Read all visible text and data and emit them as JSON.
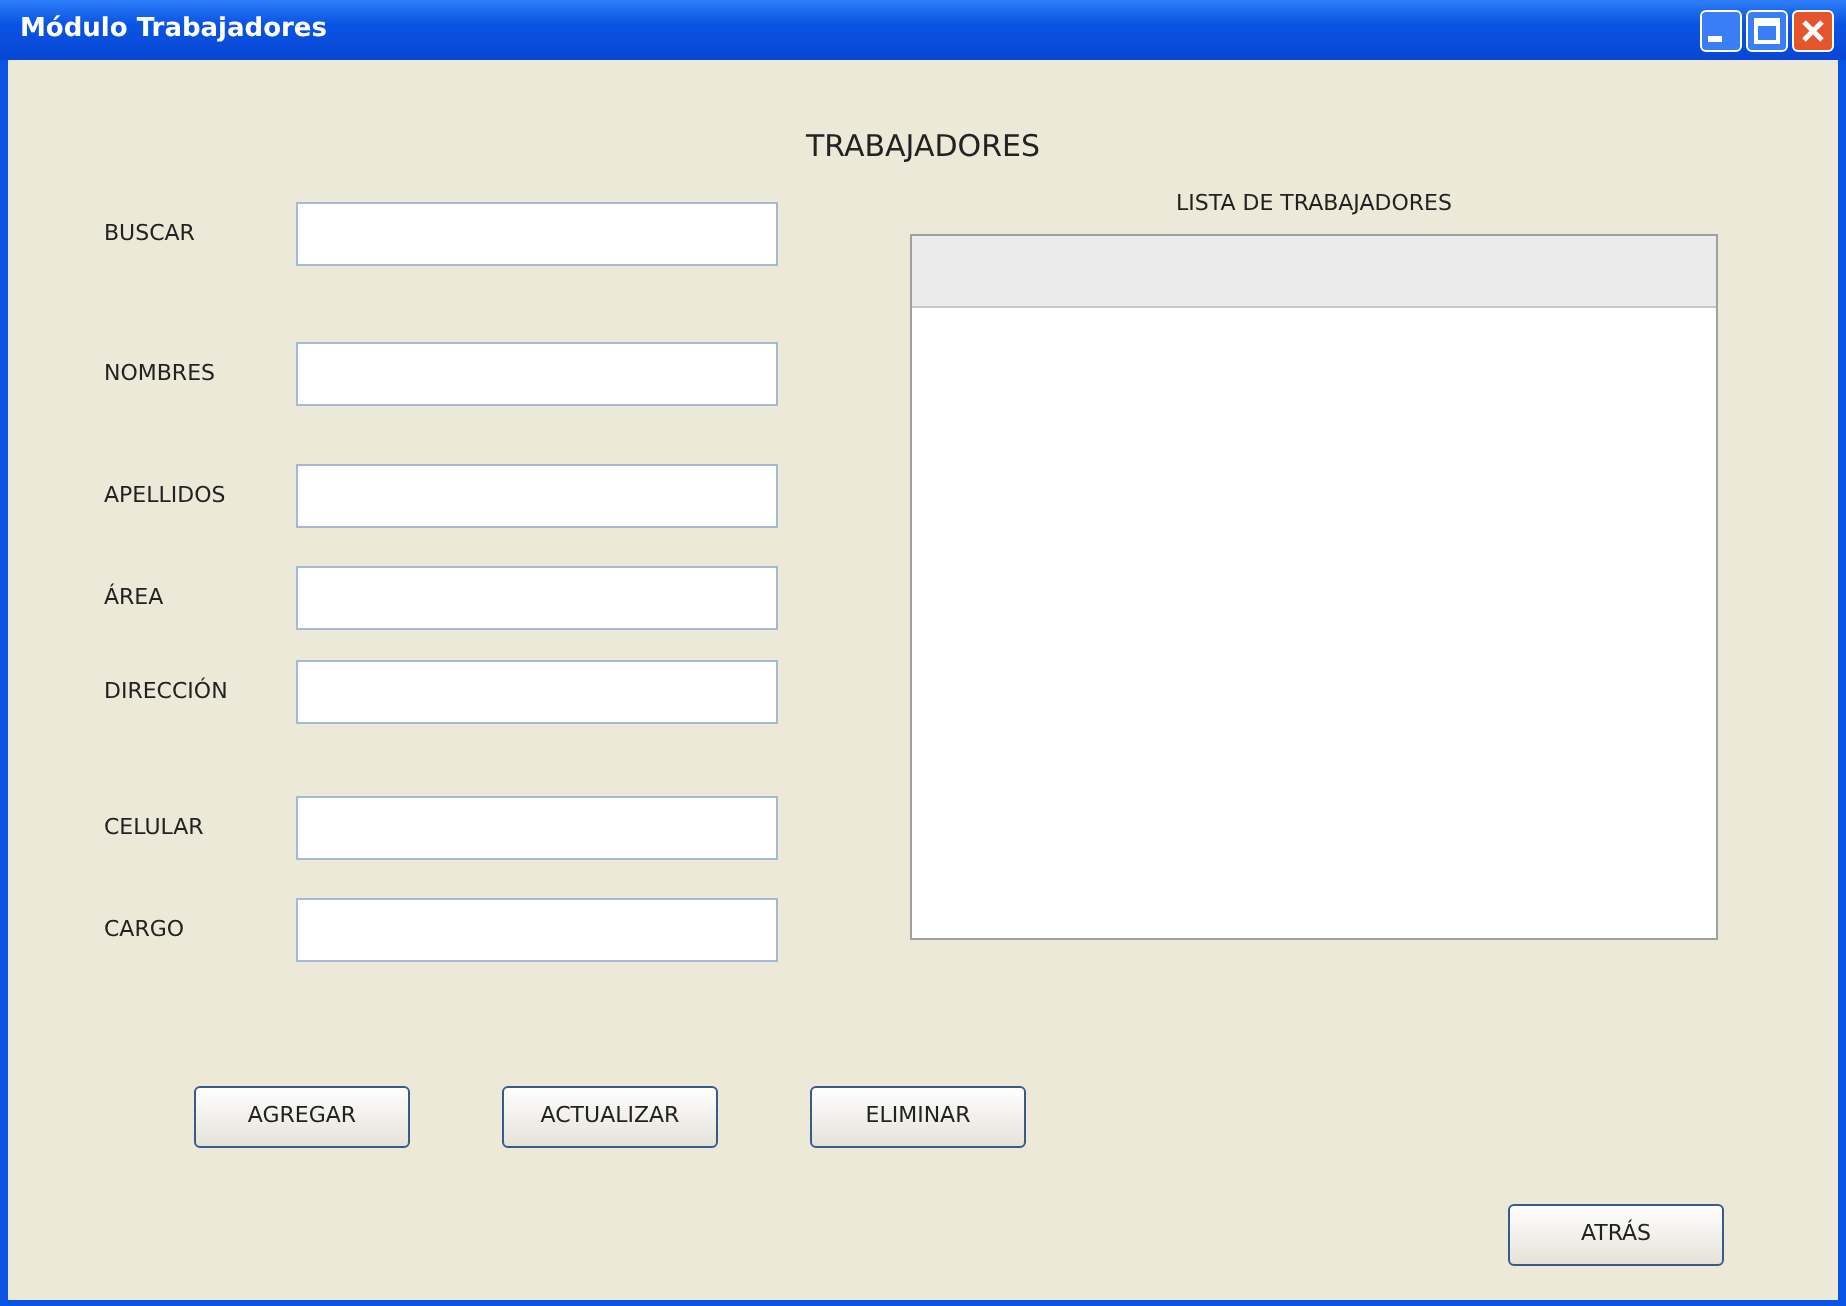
{
  "window": {
    "title": "Módulo Trabajadores",
    "controls": [
      {
        "kind": "minimize"
      },
      {
        "kind": "maximize"
      },
      {
        "kind": "close"
      }
    ]
  },
  "heading": "TRABAJADORES",
  "fields": [
    {
      "label": "BUSCAR"
    },
    {
      "label": "NOMBRES"
    },
    {
      "label": "APELLIDOS"
    },
    {
      "label": "ÁREA"
    },
    {
      "label": "DIRECCIÓN"
    },
    {
      "label": "CELULAR"
    },
    {
      "label": "CARGO"
    }
  ],
  "list": {
    "title": "LISTA DE TRABAJADORES"
  },
  "buttons": [
    "AGREGAR",
    "ACTUALIZAR",
    "ELIMINAR"
  ],
  "back_button": "ATRÁS"
}
